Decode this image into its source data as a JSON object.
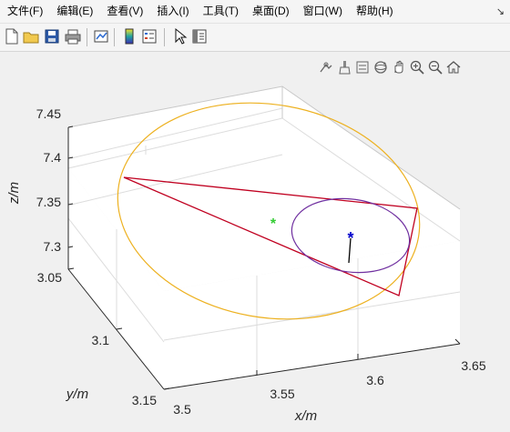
{
  "menubar": {
    "items": [
      {
        "label": "文件(F)"
      },
      {
        "label": "编辑(E)"
      },
      {
        "label": "查看(V)"
      },
      {
        "label": "插入(I)"
      },
      {
        "label": "工具(T)"
      },
      {
        "label": "桌面(D)"
      },
      {
        "label": "窗口(W)"
      },
      {
        "label": "帮助(H)"
      }
    ],
    "corner_arrow": "↘"
  },
  "toolbar": {
    "icons": [
      "new-file-icon",
      "open-folder-icon",
      "save-icon",
      "print-icon",
      "link-plot-icon",
      "colorbar-icon",
      "legend-icon",
      "pointer-icon",
      "property-editor-icon"
    ]
  },
  "axes_toolbar": {
    "icons": [
      "data-tip-icon",
      "brush-icon",
      "data-cursor-icon",
      "rotate-3d-icon",
      "pan-icon",
      "zoom-in-icon",
      "zoom-out-icon",
      "home-icon"
    ]
  },
  "chart_data": {
    "type": "scatter",
    "view": "3d",
    "grid": true,
    "xlabel": "x/m",
    "ylabel": "y/m",
    "zlabel": "z/m",
    "xticks": [
      "3.5",
      "3.55",
      "3.6",
      "3.65"
    ],
    "yticks": [
      "3.05",
      "3.1",
      "3.15"
    ],
    "zticks": [
      "7.3",
      "7.35",
      "7.4",
      "7.45"
    ],
    "xlim": [
      3.5,
      3.65
    ],
    "ylim": [
      3.05,
      3.15
    ],
    "zlim": [
      7.3,
      7.45
    ],
    "series": [
      {
        "style": "orange ellipse",
        "color": "#edb120"
      },
      {
        "style": "red triangle",
        "color": "#c00020"
      },
      {
        "style": "purple circle (incircle)",
        "color": "#7030a0"
      },
      {
        "style": "green star marker",
        "color": "#33cc33"
      },
      {
        "style": "blue star marker with black vector",
        "color": "#0000cc"
      }
    ]
  },
  "colors": {
    "background": "#f0f0f0",
    "axes_face": "#ffffff",
    "grid": "#dcdcdc",
    "ellipse": "#edb120",
    "triangle": "#c00020",
    "incircle": "#7030a0",
    "green_marker": "#33cc33",
    "blue_marker": "#0000cc"
  }
}
